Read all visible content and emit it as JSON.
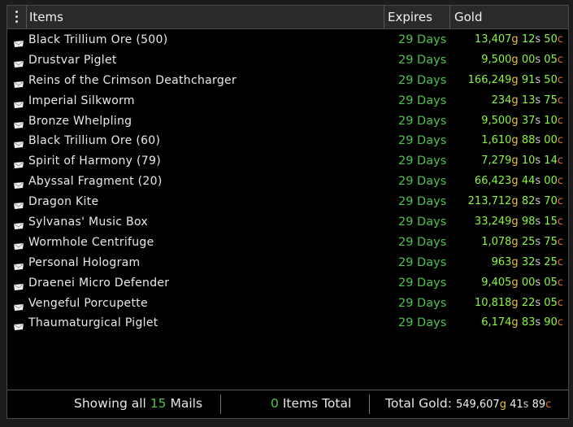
{
  "header": {
    "menu_icon": "kebab-menu-icon",
    "col_items": "Items",
    "col_expires": "Expires",
    "col_gold": "Gold"
  },
  "units": {
    "g": "g",
    "s": "s",
    "c": "c"
  },
  "colors": {
    "expires_green": "#4ec24e",
    "value_green": "#8cf542",
    "gold_unit": "#e8c03c",
    "silver_unit": "#c9c9c9",
    "copper_unit": "#d8703a"
  },
  "rows": [
    {
      "name": "Black Trillium Ore (500)",
      "expires": "29 Days",
      "gold": "13,407",
      "silver": "12",
      "copper": "50"
    },
    {
      "name": "Drustvar Piglet",
      "expires": "29 Days",
      "gold": "9,500",
      "silver": "00",
      "copper": "05"
    },
    {
      "name": "Reins of the Crimson Deathcharger",
      "expires": "29 Days",
      "gold": "166,249",
      "silver": "91",
      "copper": "50"
    },
    {
      "name": "Imperial Silkworm",
      "expires": "29 Days",
      "gold": "234",
      "silver": "13",
      "copper": "75"
    },
    {
      "name": "Bronze Whelpling",
      "expires": "29 Days",
      "gold": "9,500",
      "silver": "37",
      "copper": "10"
    },
    {
      "name": "Black Trillium Ore (60)",
      "expires": "29 Days",
      "gold": "1,610",
      "silver": "88",
      "copper": "00"
    },
    {
      "name": "Spirit of Harmony (79)",
      "expires": "29 Days",
      "gold": "7,279",
      "silver": "10",
      "copper": "14"
    },
    {
      "name": "Abyssal Fragment (20)",
      "expires": "29 Days",
      "gold": "66,423",
      "silver": "44",
      "copper": "00"
    },
    {
      "name": "Dragon Kite",
      "expires": "29 Days",
      "gold": "213,712",
      "silver": "82",
      "copper": "70"
    },
    {
      "name": "Sylvanas' Music Box",
      "expires": "29 Days",
      "gold": "33,249",
      "silver": "98",
      "copper": "15"
    },
    {
      "name": "Wormhole Centrifuge",
      "expires": "29 Days",
      "gold": "1,078",
      "silver": "25",
      "copper": "75"
    },
    {
      "name": "Personal Hologram",
      "expires": "29 Days",
      "gold": "963",
      "silver": "32",
      "copper": "25"
    },
    {
      "name": "Draenei Micro Defender",
      "expires": "29 Days",
      "gold": "9,405",
      "silver": "00",
      "copper": "05"
    },
    {
      "name": "Vengeful Porcupette",
      "expires": "29 Days",
      "gold": "10,818",
      "silver": "22",
      "copper": "05"
    },
    {
      "name": "Thaumaturgical Piglet",
      "expires": "29 Days",
      "gold": "6,174",
      "silver": "83",
      "copper": "90"
    }
  ],
  "footer": {
    "showing_prefix": "Showing all",
    "mail_count": "15",
    "showing_suffix": "Mails",
    "items_count": "0",
    "items_suffix": "Items Total",
    "total_label": "Total Gold:",
    "total_gold": "549,607",
    "total_silver": "41",
    "total_copper": "89"
  }
}
